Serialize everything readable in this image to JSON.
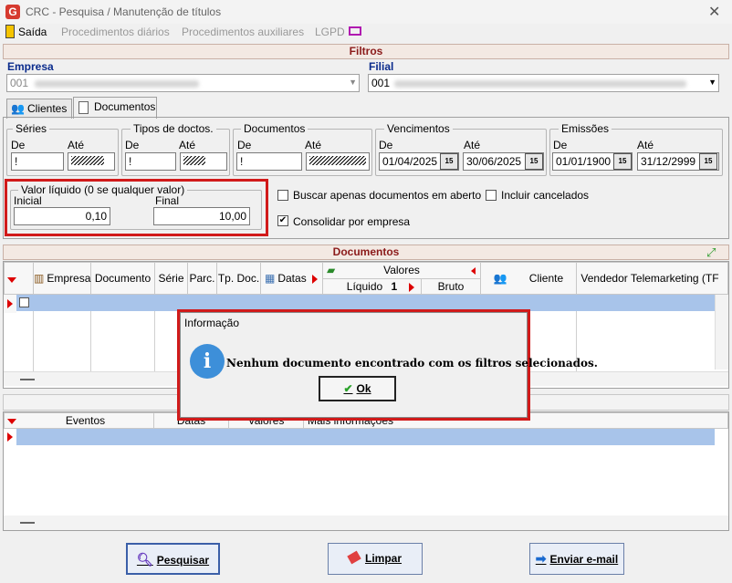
{
  "window": {
    "title": "CRC - Pesquisa / Manutenção de títulos",
    "close": "✕"
  },
  "menu": {
    "items": [
      "Saída",
      "Procedimentos diários",
      "Procedimentos auxiliares",
      "LGPD"
    ]
  },
  "filters": {
    "header": "Filtros",
    "empresa": {
      "label": "Empresa",
      "value": "001"
    },
    "filial": {
      "label": "Filial",
      "value": "001"
    },
    "tabs": [
      "Clientes",
      "Documentos"
    ],
    "series": {
      "title": "Séries",
      "de": "De",
      "ate": "Até",
      "de_value": "!"
    },
    "tipos": {
      "title": "Tipos de doctos.",
      "de": "De",
      "ate": "Até",
      "de_value": "!"
    },
    "documentos": {
      "title": "Documentos",
      "de": "De",
      "ate": "Até",
      "de_value": "!"
    },
    "vencimentos": {
      "title": "Vencimentos",
      "de": "De",
      "ate": "Até",
      "de_value": "01/04/2025",
      "ate_value": "30/06/2025"
    },
    "emissoes": {
      "title": "Emissões",
      "de": "De",
      "ate": "Até",
      "de_value": "01/01/1900",
      "ate_value": "31/12/2999"
    },
    "valor": {
      "title": "Valor líquido (0 se qualquer valor)",
      "inicial": "Inicial",
      "final": "Final",
      "inicial_value": "0,10",
      "final_value": "10,00"
    },
    "options": {
      "abertos": "Buscar apenas documentos em aberto",
      "cancelados": "Incluir cancelados",
      "consolidar": "Consolidar por empresa"
    },
    "consolidar_checked": "✔"
  },
  "documents": {
    "header": "Documentos",
    "columns": {
      "empresa": "Empresa",
      "documento": "Documento",
      "serie": "Série",
      "parc": "Parc.",
      "tipo": "Tp. Doc.",
      "datas": "Datas",
      "valores": "Valores",
      "liquido": "Líquido",
      "liquido_n": "1",
      "bruto": "Bruto",
      "cliente": "Cliente",
      "vendedor": "Vendedor Telemarketing (TF"
    }
  },
  "events": {
    "columns": {
      "eventos": "Eventos",
      "datas": "Datas",
      "valores": "Valores",
      "mais": "Mais informações"
    }
  },
  "dialog": {
    "title": "Informação",
    "message": "Nenhum documento encontrado com os filtros selecionados.",
    "ok": "Ok",
    "icon": "i"
  },
  "buttons": {
    "pesquisar": "Pesquisar",
    "limpar": "Limpar",
    "enviar": "Enviar e-mail"
  },
  "calendar_icon": "15"
}
